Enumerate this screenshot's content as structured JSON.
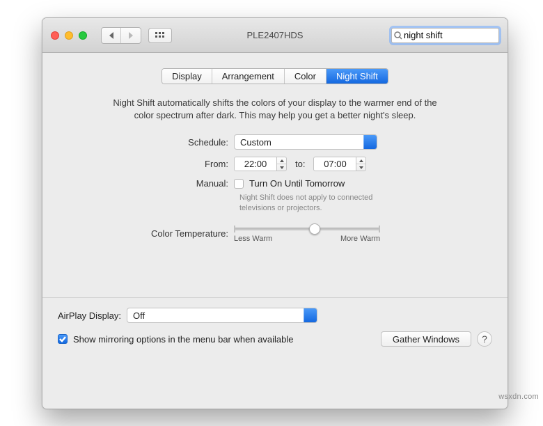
{
  "window_title": "PLE2407HDS",
  "search": {
    "value": "night shift"
  },
  "tabs": [
    {
      "label": "Display",
      "active": false
    },
    {
      "label": "Arrangement",
      "active": false
    },
    {
      "label": "Color",
      "active": false
    },
    {
      "label": "Night Shift",
      "active": true
    }
  ],
  "description": "Night Shift automatically shifts the colors of your display to the warmer end of the color spectrum after dark. This may help you get a better night's sleep.",
  "labels": {
    "schedule": "Schedule:",
    "from": "From:",
    "to": "to:",
    "manual": "Manual:",
    "turn_on": "Turn On Until Tomorrow",
    "color_temp": "Color Temperature:",
    "less_warm": "Less Warm",
    "more_warm": "More Warm",
    "airplay": "AirPlay Display:",
    "show_mirror": "Show mirroring options in the menu bar when available",
    "gather": "Gather Windows"
  },
  "values": {
    "schedule": "Custom",
    "from_time": "22:00",
    "to_time": "07:00",
    "manual_checked": false,
    "slider_percent": 55,
    "airplay": "Off",
    "show_mirror_checked": true
  },
  "hint": "Night Shift does not apply to connected televisions or projectors.",
  "watermark": "wsxdn.com"
}
